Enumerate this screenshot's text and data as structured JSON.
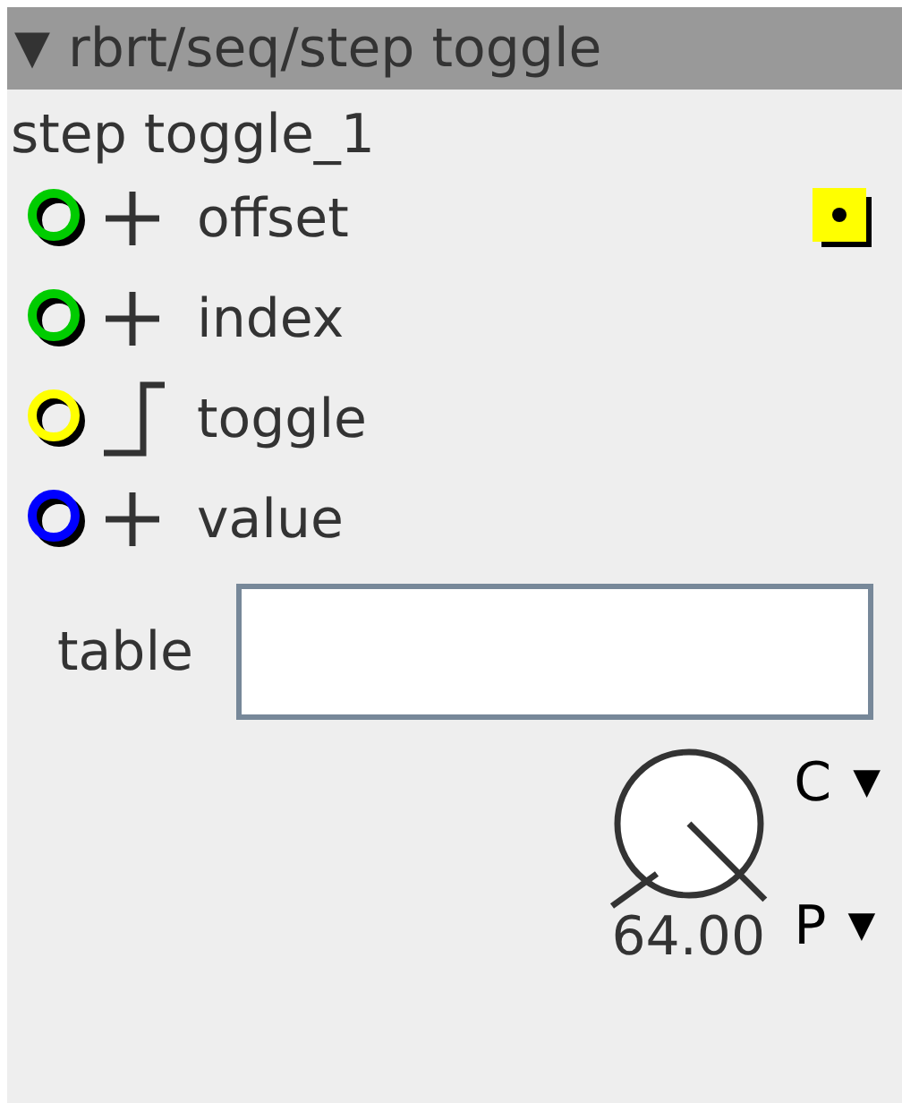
{
  "header": {
    "toggle": "▼",
    "title": "rbrt/seq/step toggle"
  },
  "instance": "step toggle_1",
  "inlets": [
    {
      "label": "offset",
      "kind": "plus",
      "color": "#00cc00",
      "active_marker": true
    },
    {
      "label": "index",
      "kind": "plus",
      "color": "#00cc00",
      "active_marker": false
    },
    {
      "label": "toggle",
      "kind": "step",
      "color": "#ffff00",
      "active_marker": false
    },
    {
      "label": "value",
      "kind": "plus",
      "color": "#0000ff",
      "active_marker": false
    }
  ],
  "table": {
    "label": "table"
  },
  "knob": {
    "reading": "64.00",
    "menus": [
      {
        "label": "C",
        "caret": "▼"
      },
      {
        "label": "P",
        "caret": "▼"
      }
    ]
  }
}
